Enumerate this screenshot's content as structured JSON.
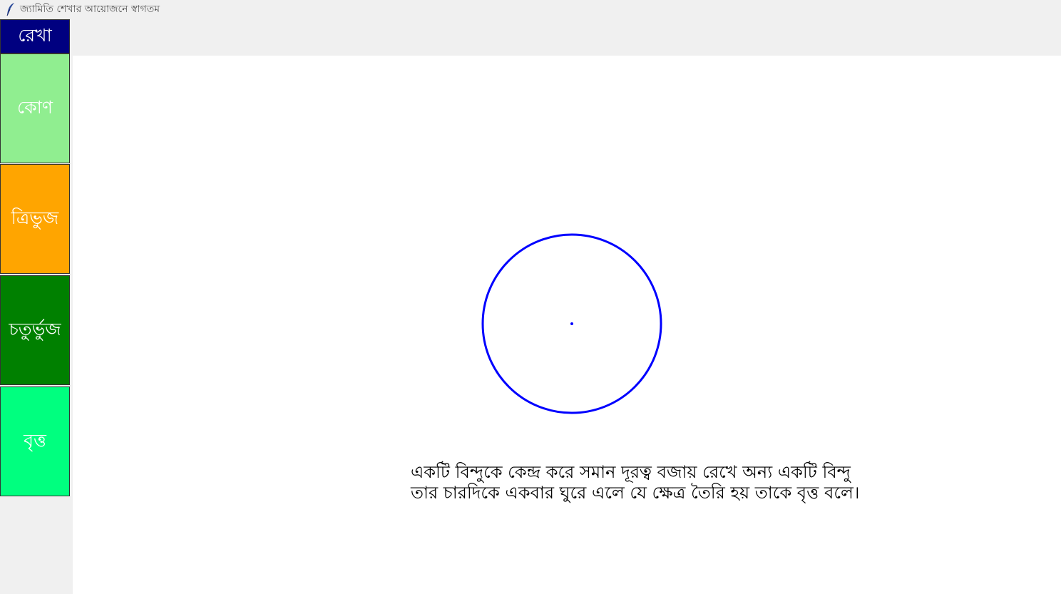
{
  "window": {
    "title": "জ্যামিতি শেখার আয়োজনে স্বাগতম",
    "icon": "feather-icon"
  },
  "sidebar": {
    "items": [
      {
        "label": "রেখা",
        "color": "#000080"
      },
      {
        "label": "কোণ",
        "color": "#90ee90"
      },
      {
        "label": "ত্রিভুজ",
        "color": "#ffa500"
      },
      {
        "label": "চতুর্ভুজ",
        "color": "#008000"
      },
      {
        "label": "বৃত্ত",
        "color": "#00ff7f"
      }
    ]
  },
  "canvas": {
    "shape": "circle",
    "stroke_color": "#0000ff",
    "description_line1": "একটি বিন্দুকে কেন্দ্র করে সমান দূরত্ব বজায় রেখে অন্য একটি বিন্দু",
    "description_line2": "তার চারদিকে একবার ঘুরে এলে যে ক্ষেত্র তৈরি হয় তাকে বৃত্ত বলে।"
  }
}
